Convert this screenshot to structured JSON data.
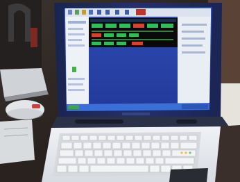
{
  "photo": {
    "subject": "laptop-with-trading-screen",
    "colors": {
      "screen_background": "#2b46a8",
      "screen_sidebar": "#f2f4f8",
      "ticker_panel": "#0a0a0a",
      "ticker_green": "#3ddc5a",
      "ticker_red": "#e0402a",
      "taskbar": "#3a6fd8",
      "laptop_body": "#e8eaee",
      "bezel": "#1c2a55",
      "desk": "#3a2e28"
    }
  }
}
